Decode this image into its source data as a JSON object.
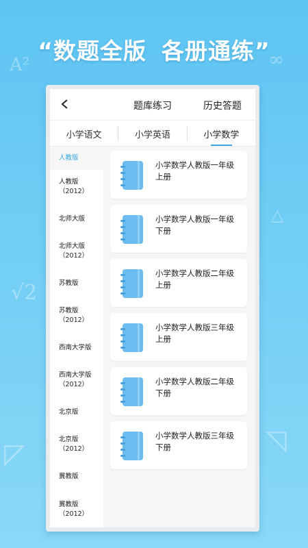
{
  "headline": {
    "left": "“数题全版",
    "right": "各册通练”"
  },
  "header": {
    "back_icon": "chevron-left-icon",
    "title": "题库练习",
    "history": "历史答题"
  },
  "tabs": [
    {
      "label": "小学语文",
      "active": false
    },
    {
      "label": "小学英语",
      "active": false
    },
    {
      "label": "小学数学",
      "active": true
    }
  ],
  "sidebar": {
    "items": [
      {
        "line1": "人教版",
        "line2": "",
        "active": true
      },
      {
        "line1": "人教版",
        "line2": "（2012）",
        "active": false
      },
      {
        "line1": "北师大版",
        "line2": "",
        "active": false
      },
      {
        "line1": "北师大版",
        "line2": "（2012）",
        "active": false
      },
      {
        "line1": "苏教版",
        "line2": "",
        "active": false
      },
      {
        "line1": "苏教版",
        "line2": "（2012）",
        "active": false
      },
      {
        "line1": "西南大学版",
        "line2": "",
        "active": false
      },
      {
        "line1": "西南大学版",
        "line2": "（2012）",
        "active": false
      },
      {
        "line1": "北京版",
        "line2": "",
        "active": false
      },
      {
        "line1": "北京版",
        "line2": "（2012）",
        "active": false
      },
      {
        "line1": "冀教版",
        "line2": "",
        "active": false
      },
      {
        "line1": "冀教版",
        "line2": "（2012）",
        "active": false
      }
    ]
  },
  "books": [
    {
      "title": "小学数学人教版一年级上册",
      "icon": "notebook-icon"
    },
    {
      "title": "小学数学人教版一年级下册",
      "icon": "notebook-icon"
    },
    {
      "title": "小学数学人教版二年级上册",
      "icon": "notebook-icon"
    },
    {
      "title": "小学数学人教版三年级上册",
      "icon": "notebook-icon"
    },
    {
      "title": "小学数学人教版二年级下册",
      "icon": "notebook-icon"
    },
    {
      "title": "小学数学人教版三年级下册",
      "icon": "notebook-icon"
    }
  ],
  "colors": {
    "accent": "#3aa8e8",
    "background": "#6ccbf4",
    "book_icon": "#6cbcf0"
  }
}
